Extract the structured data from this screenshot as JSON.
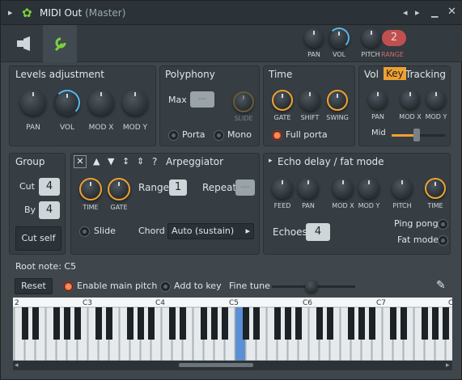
{
  "window": {
    "title": "MIDI Out",
    "subtitle": "(Master)"
  },
  "titlebar_icons": [
    "chevron-right-icon",
    "gear-icon",
    "prev-icon",
    "next-icon",
    "minimize-icon",
    "close-icon"
  ],
  "header": {
    "tabs": [
      "plug-icon",
      "wrench-icon"
    ],
    "knobs": [
      {
        "label": "PAN"
      },
      {
        "label": "VOL"
      },
      {
        "label": "PITCH"
      }
    ],
    "range_value": "2",
    "range_label": "RANGE"
  },
  "levels": {
    "title": "Levels adjustment",
    "knobs": [
      "PAN",
      "VOL",
      "MOD X",
      "MOD Y"
    ]
  },
  "polyphony": {
    "title": "Polyphony",
    "max_label": "Max",
    "max_value": "---",
    "slide_label": "SLIDE",
    "porta": "Porta",
    "mono": "Mono"
  },
  "time": {
    "title": "Time",
    "knobs": [
      "GATE",
      "SHIFT",
      "SWING"
    ],
    "full_porta": "Full porta"
  },
  "vkt": {
    "tabs": [
      "Vol",
      "Key",
      "Tracking"
    ],
    "knobs": [
      "PAN",
      "MOD X",
      "MOD Y"
    ],
    "mid_label": "Mid"
  },
  "group": {
    "title": "Group",
    "cut_label": "Cut",
    "cut_value": "4",
    "by_label": "By",
    "by_value": "4",
    "cut_self": "Cut self"
  },
  "arp": {
    "title": "Arpeggiator",
    "help": "?",
    "knobs": [
      "TIME",
      "GATE"
    ],
    "range_label": "Range",
    "range_value": "1",
    "repeat_label": "Repeat",
    "repeat_value": "---",
    "slide": "Slide",
    "chord_label": "Chord",
    "chord_value": "Auto (sustain)"
  },
  "echo": {
    "title": "Echo delay / fat mode",
    "knobs": [
      "FEED",
      "PAN",
      "MOD X",
      "MOD Y",
      "PITCH",
      "TIME"
    ],
    "echoes_label": "Echoes",
    "echoes_value": "4",
    "ping_pong": "Ping pong",
    "fat_mode": "Fat mode"
  },
  "root": {
    "title": "Root note: C5",
    "reset": "Reset",
    "enable_main_pitch": "Enable main pitch",
    "add_to_key": "Add to key",
    "fine_tune": "Fine tune"
  },
  "keyboard": {
    "octave_labels": [
      "2",
      "C3",
      "C4",
      "C5",
      "C6",
      "C7",
      "C"
    ],
    "highlight_note": "C5",
    "highlight_color": "#5b8fd6"
  },
  "colors": {
    "accent": "#f0a030",
    "active_radio": "#ff8a5c",
    "blue": "#58b6e8",
    "green": "#7fd13b"
  }
}
